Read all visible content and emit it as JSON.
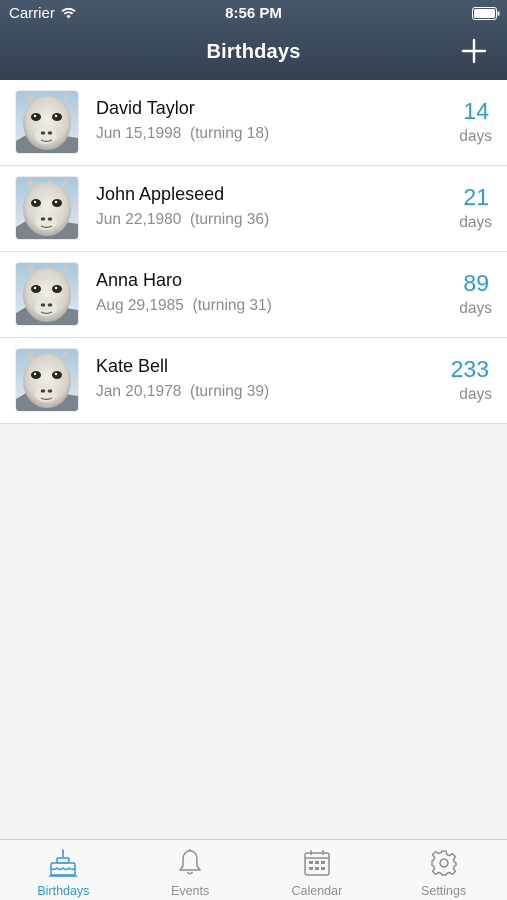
{
  "status_bar": {
    "carrier": "Carrier",
    "time": "8:56 PM",
    "wifi_icon": "wifi-icon",
    "battery_icon": "battery-icon"
  },
  "nav": {
    "title": "Birthdays",
    "add_icon": "plus-icon"
  },
  "colors": {
    "accent": "#2a9be0",
    "header": "#3b4a5c",
    "secondary_text": "#8a8a8f"
  },
  "birthdays": [
    {
      "name": "David Taylor",
      "detail": "Jun 15,1998  (turning 18)",
      "count": "14",
      "unit": "days"
    },
    {
      "name": "John Appleseed",
      "detail": "Jun 22,1980  (turning 36)",
      "count": "21",
      "unit": "days"
    },
    {
      "name": "Anna Haro",
      "detail": "Aug 29,1985  (turning 31)",
      "count": "89",
      "unit": "days"
    },
    {
      "name": "Kate Bell",
      "detail": "Jan 20,1978  (turning 39)",
      "count": "233",
      "unit": "days"
    }
  ],
  "tabs": [
    {
      "label": "Birthdays",
      "icon": "cake-icon",
      "active": true
    },
    {
      "label": "Events",
      "icon": "bell-icon",
      "active": false
    },
    {
      "label": "Calendar",
      "icon": "calendar-icon",
      "active": false
    },
    {
      "label": "Settings",
      "icon": "gear-icon",
      "active": false
    }
  ]
}
